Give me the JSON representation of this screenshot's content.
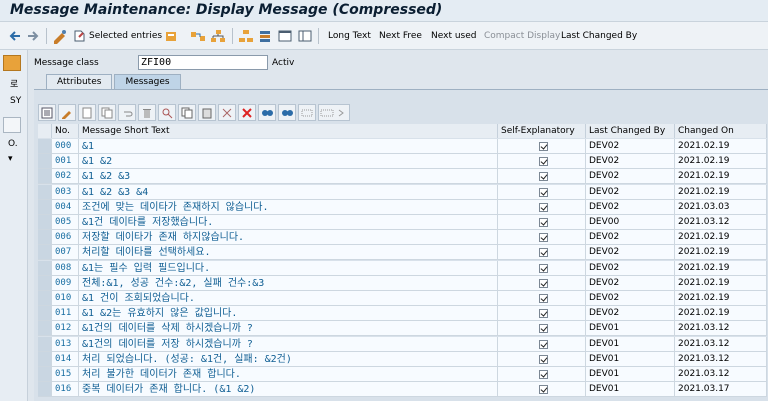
{
  "window": {
    "title": "Message Maintenance: Display Message (Compressed)"
  },
  "toolbar": {
    "selected_entries": "Selected entries",
    "long_text": "Long Text",
    "next_free": "Next Free",
    "next_used": "Next used",
    "compact_display": "Compact Display",
    "last_changed_by": "Last Changed By"
  },
  "left": {
    "items": [
      "로",
      "SY",
      "O."
    ]
  },
  "header": {
    "message_class_label": "Message class",
    "message_class_value": "ZFI00",
    "status": "Activ"
  },
  "tabs": [
    {
      "label": "Attributes"
    },
    {
      "label": "Messages"
    }
  ],
  "grid": {
    "columns": [
      "No.",
      "Message Short Text",
      "Self-Explanatory",
      "Last Changed By",
      "Changed On"
    ],
    "rows": [
      {
        "no": "000",
        "text": "&1",
        "self_explanatory": true,
        "changed_by": "DEV02",
        "changed_on": "2021.02.19"
      },
      {
        "no": "001",
        "text": "&1 &2",
        "self_explanatory": true,
        "changed_by": "DEV02",
        "changed_on": "2021.02.19"
      },
      {
        "no": "002",
        "text": "&1 &2 &3",
        "self_explanatory": true,
        "changed_by": "DEV02",
        "changed_on": "2021.02.19"
      },
      {
        "no": "003",
        "text": "&1 &2 &3 &4",
        "self_explanatory": true,
        "changed_by": "DEV02",
        "changed_on": "2021.02.19"
      },
      {
        "no": "004",
        "text": "조건에 맞는 데이타가 존재하지 않습니다.",
        "self_explanatory": true,
        "changed_by": "DEV02",
        "changed_on": "2021.03.03"
      },
      {
        "no": "005",
        "text": "&1건 데이타를 저장했습니다.",
        "self_explanatory": true,
        "changed_by": "DEV00",
        "changed_on": "2021.03.12"
      },
      {
        "no": "006",
        "text": "저장할 데이타가 존재 하지않습니다.",
        "self_explanatory": true,
        "changed_by": "DEV02",
        "changed_on": "2021.02.19"
      },
      {
        "no": "007",
        "text": "처리할 데이타를 선택하세요.",
        "self_explanatory": true,
        "changed_by": "DEV02",
        "changed_on": "2021.02.19"
      },
      {
        "no": "008",
        "text": "&1는 필수 입력 필드입니다.",
        "self_explanatory": true,
        "changed_by": "DEV02",
        "changed_on": "2021.02.19"
      },
      {
        "no": "009",
        "text": "전체:&1, 성공 건수:&2, 실패 건수:&3",
        "self_explanatory": true,
        "changed_by": "DEV02",
        "changed_on": "2021.02.19"
      },
      {
        "no": "010",
        "text": "&1 건이 조회되었습니다.",
        "self_explanatory": true,
        "changed_by": "DEV02",
        "changed_on": "2021.02.19"
      },
      {
        "no": "011",
        "text": "&1 &2는 유효하지 않은 값입니다.",
        "self_explanatory": true,
        "changed_by": "DEV02",
        "changed_on": "2021.02.19"
      },
      {
        "no": "012",
        "text": "&1건의 데이터를 삭제 하시겠습니까 ?",
        "self_explanatory": true,
        "changed_by": "DEV01",
        "changed_on": "2021.03.12"
      },
      {
        "no": "013",
        "text": "&1건의 데이터를 저장 하시겠습니까 ?",
        "self_explanatory": true,
        "changed_by": "DEV01",
        "changed_on": "2021.03.12"
      },
      {
        "no": "014",
        "text": "처리 되었습니다. (성공: &1건, 실패: &2건)",
        "self_explanatory": true,
        "changed_by": "DEV01",
        "changed_on": "2021.03.12"
      },
      {
        "no": "015",
        "text": "처리 불가한 데이터가 존재 합니다.",
        "self_explanatory": true,
        "changed_by": "DEV01",
        "changed_on": "2021.03.12"
      },
      {
        "no": "016",
        "text": "중복 데이터가 존재 합니다. (&1 &2)",
        "self_explanatory": true,
        "changed_by": "DEV01",
        "changed_on": "2021.03.17"
      }
    ]
  },
  "colors": {
    "accent": "#0f5e93",
    "background": "#dfe6ed"
  }
}
